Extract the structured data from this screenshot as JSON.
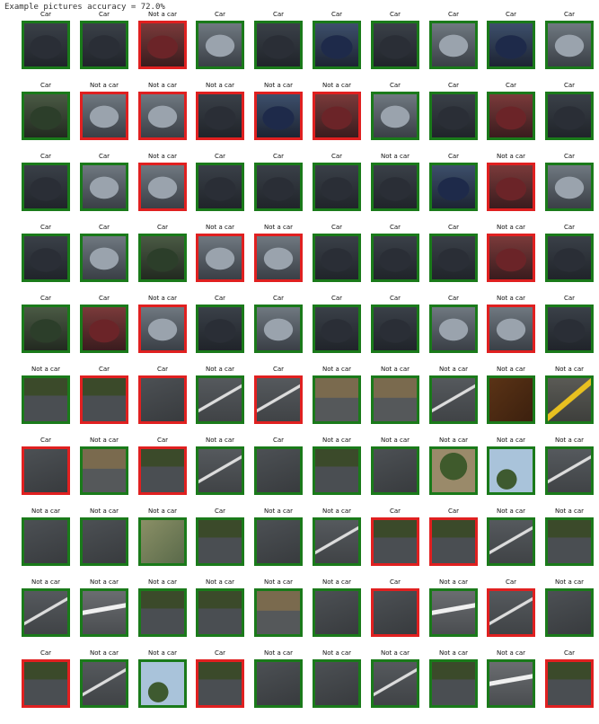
{
  "heading": "Example pictures accuracy = 72.0%",
  "labels": {
    "car": "Car",
    "not_car": "Not a car"
  },
  "colors": {
    "correct": "#1a7a1a",
    "incorrect": "#e02020"
  },
  "grid": [
    [
      {
        "p": "Car",
        "ok": true,
        "img": "car"
      },
      {
        "p": "Car",
        "ok": true,
        "img": "car"
      },
      {
        "p": "Not a car",
        "ok": false,
        "img": "car-red"
      },
      {
        "p": "Car",
        "ok": true,
        "img": "car-light"
      },
      {
        "p": "Car",
        "ok": true,
        "img": "car"
      },
      {
        "p": "Car",
        "ok": true,
        "img": "car-blue"
      },
      {
        "p": "Car",
        "ok": true,
        "img": "car"
      },
      {
        "p": "Car",
        "ok": true,
        "img": "car-light"
      },
      {
        "p": "Car",
        "ok": true,
        "img": "car-blue"
      },
      {
        "p": "Car",
        "ok": true,
        "img": "car-light"
      }
    ],
    [
      {
        "p": "Car",
        "ok": true,
        "img": "car-green"
      },
      {
        "p": "Not a car",
        "ok": false,
        "img": "car-light"
      },
      {
        "p": "Not a car",
        "ok": false,
        "img": "car-light"
      },
      {
        "p": "Not a car",
        "ok": false,
        "img": "car"
      },
      {
        "p": "Not a car",
        "ok": false,
        "img": "car-blue"
      },
      {
        "p": "Not a car",
        "ok": false,
        "img": "car-red"
      },
      {
        "p": "Car",
        "ok": true,
        "img": "car-light"
      },
      {
        "p": "Car",
        "ok": true,
        "img": "car"
      },
      {
        "p": "Car",
        "ok": true,
        "img": "car-red"
      },
      {
        "p": "Car",
        "ok": true,
        "img": "car"
      }
    ],
    [
      {
        "p": "Car",
        "ok": true,
        "img": "car"
      },
      {
        "p": "Car",
        "ok": true,
        "img": "car-light"
      },
      {
        "p": "Not a car",
        "ok": false,
        "img": "car-light"
      },
      {
        "p": "Car",
        "ok": true,
        "img": "car"
      },
      {
        "p": "Car",
        "ok": true,
        "img": "car"
      },
      {
        "p": "Car",
        "ok": true,
        "img": "car"
      },
      {
        "p": "Not a car",
        "ok": true,
        "img": "car"
      },
      {
        "p": "Car",
        "ok": true,
        "img": "car-blue"
      },
      {
        "p": "Not a car",
        "ok": false,
        "img": "car-red"
      },
      {
        "p": "Car",
        "ok": true,
        "img": "car-light"
      }
    ],
    [
      {
        "p": "Car",
        "ok": true,
        "img": "car"
      },
      {
        "p": "Car",
        "ok": true,
        "img": "car-light"
      },
      {
        "p": "Car",
        "ok": true,
        "img": "car-green"
      },
      {
        "p": "Not a car",
        "ok": false,
        "img": "car-light"
      },
      {
        "p": "Not a car",
        "ok": false,
        "img": "car-light"
      },
      {
        "p": "Car",
        "ok": true,
        "img": "car"
      },
      {
        "p": "Car",
        "ok": true,
        "img": "car"
      },
      {
        "p": "Car",
        "ok": true,
        "img": "car"
      },
      {
        "p": "Not a car",
        "ok": false,
        "img": "car-red"
      },
      {
        "p": "Car",
        "ok": true,
        "img": "car"
      }
    ],
    [
      {
        "p": "Car",
        "ok": true,
        "img": "car-green"
      },
      {
        "p": "Car",
        "ok": true,
        "img": "car-red"
      },
      {
        "p": "Not a car",
        "ok": false,
        "img": "car-light"
      },
      {
        "p": "Car",
        "ok": true,
        "img": "car"
      },
      {
        "p": "Car",
        "ok": true,
        "img": "car-light"
      },
      {
        "p": "Car",
        "ok": true,
        "img": "car"
      },
      {
        "p": "Car",
        "ok": true,
        "img": "car"
      },
      {
        "p": "Car",
        "ok": true,
        "img": "car-light"
      },
      {
        "p": "Not a car",
        "ok": false,
        "img": "car-light"
      },
      {
        "p": "Car",
        "ok": true,
        "img": "car"
      }
    ],
    [
      {
        "p": "Not a car",
        "ok": true,
        "img": "road-veg"
      },
      {
        "p": "Car",
        "ok": false,
        "img": "road-veg"
      },
      {
        "p": "Car",
        "ok": false,
        "img": "road"
      },
      {
        "p": "Not a car",
        "ok": true,
        "img": "road-line"
      },
      {
        "p": "Car",
        "ok": false,
        "img": "road-line"
      },
      {
        "p": "Not a car",
        "ok": true,
        "img": "road-dirt"
      },
      {
        "p": "Not a car",
        "ok": true,
        "img": "road-dirt"
      },
      {
        "p": "Not a car",
        "ok": true,
        "img": "road-line"
      },
      {
        "p": "Not a car",
        "ok": true,
        "img": "brown"
      },
      {
        "p": "Not a car",
        "ok": true,
        "img": "road-yellow"
      }
    ],
    [
      {
        "p": "Car",
        "ok": false,
        "img": "road"
      },
      {
        "p": "Not a car",
        "ok": true,
        "img": "road-dirt"
      },
      {
        "p": "Car",
        "ok": false,
        "img": "road-veg"
      },
      {
        "p": "Not a car",
        "ok": true,
        "img": "road-line"
      },
      {
        "p": "Car",
        "ok": true,
        "img": "road"
      },
      {
        "p": "Not a car",
        "ok": true,
        "img": "road-veg"
      },
      {
        "p": "Not a car",
        "ok": true,
        "img": "road"
      },
      {
        "p": "Not a car",
        "ok": true,
        "img": "tree"
      },
      {
        "p": "Not a car",
        "ok": true,
        "img": "sky"
      },
      {
        "p": "Not a car",
        "ok": true,
        "img": "road-line"
      }
    ],
    [
      {
        "p": "Not a car",
        "ok": true,
        "img": "road"
      },
      {
        "p": "Not a car",
        "ok": true,
        "img": "road"
      },
      {
        "p": "Not a car",
        "ok": true,
        "img": "blur"
      },
      {
        "p": "Car",
        "ok": true,
        "img": "road-veg"
      },
      {
        "p": "Not a car",
        "ok": true,
        "img": "road"
      },
      {
        "p": "Not a car",
        "ok": true,
        "img": "road-line"
      },
      {
        "p": "Car",
        "ok": false,
        "img": "road-veg"
      },
      {
        "p": "Car",
        "ok": false,
        "img": "road-veg"
      },
      {
        "p": "Not a car",
        "ok": true,
        "img": "road-line"
      },
      {
        "p": "Not a car",
        "ok": true,
        "img": "road-veg"
      }
    ],
    [
      {
        "p": "Not a car",
        "ok": true,
        "img": "road-line"
      },
      {
        "p": "Not a car",
        "ok": true,
        "img": "road-white"
      },
      {
        "p": "Not a car",
        "ok": true,
        "img": "road-veg"
      },
      {
        "p": "Not a car",
        "ok": true,
        "img": "road-veg"
      },
      {
        "p": "Not a car",
        "ok": true,
        "img": "road-dirt"
      },
      {
        "p": "Not a car",
        "ok": true,
        "img": "road"
      },
      {
        "p": "Car",
        "ok": false,
        "img": "road"
      },
      {
        "p": "Not a car",
        "ok": true,
        "img": "road-white"
      },
      {
        "p": "Car",
        "ok": false,
        "img": "road-line"
      },
      {
        "p": "Not a car",
        "ok": true,
        "img": "road"
      }
    ],
    [
      {
        "p": "Car",
        "ok": false,
        "img": "road-veg"
      },
      {
        "p": "Not a car",
        "ok": true,
        "img": "road-line"
      },
      {
        "p": "Not a car",
        "ok": true,
        "img": "sky"
      },
      {
        "p": "Car",
        "ok": false,
        "img": "road-veg"
      },
      {
        "p": "Not a car",
        "ok": true,
        "img": "road"
      },
      {
        "p": "Not a car",
        "ok": true,
        "img": "road"
      },
      {
        "p": "Not a car",
        "ok": true,
        "img": "road-line"
      },
      {
        "p": "Not a car",
        "ok": true,
        "img": "road-veg"
      },
      {
        "p": "Not a car",
        "ok": true,
        "img": "road-white"
      },
      {
        "p": "Car",
        "ok": false,
        "img": "road-veg"
      }
    ]
  ]
}
